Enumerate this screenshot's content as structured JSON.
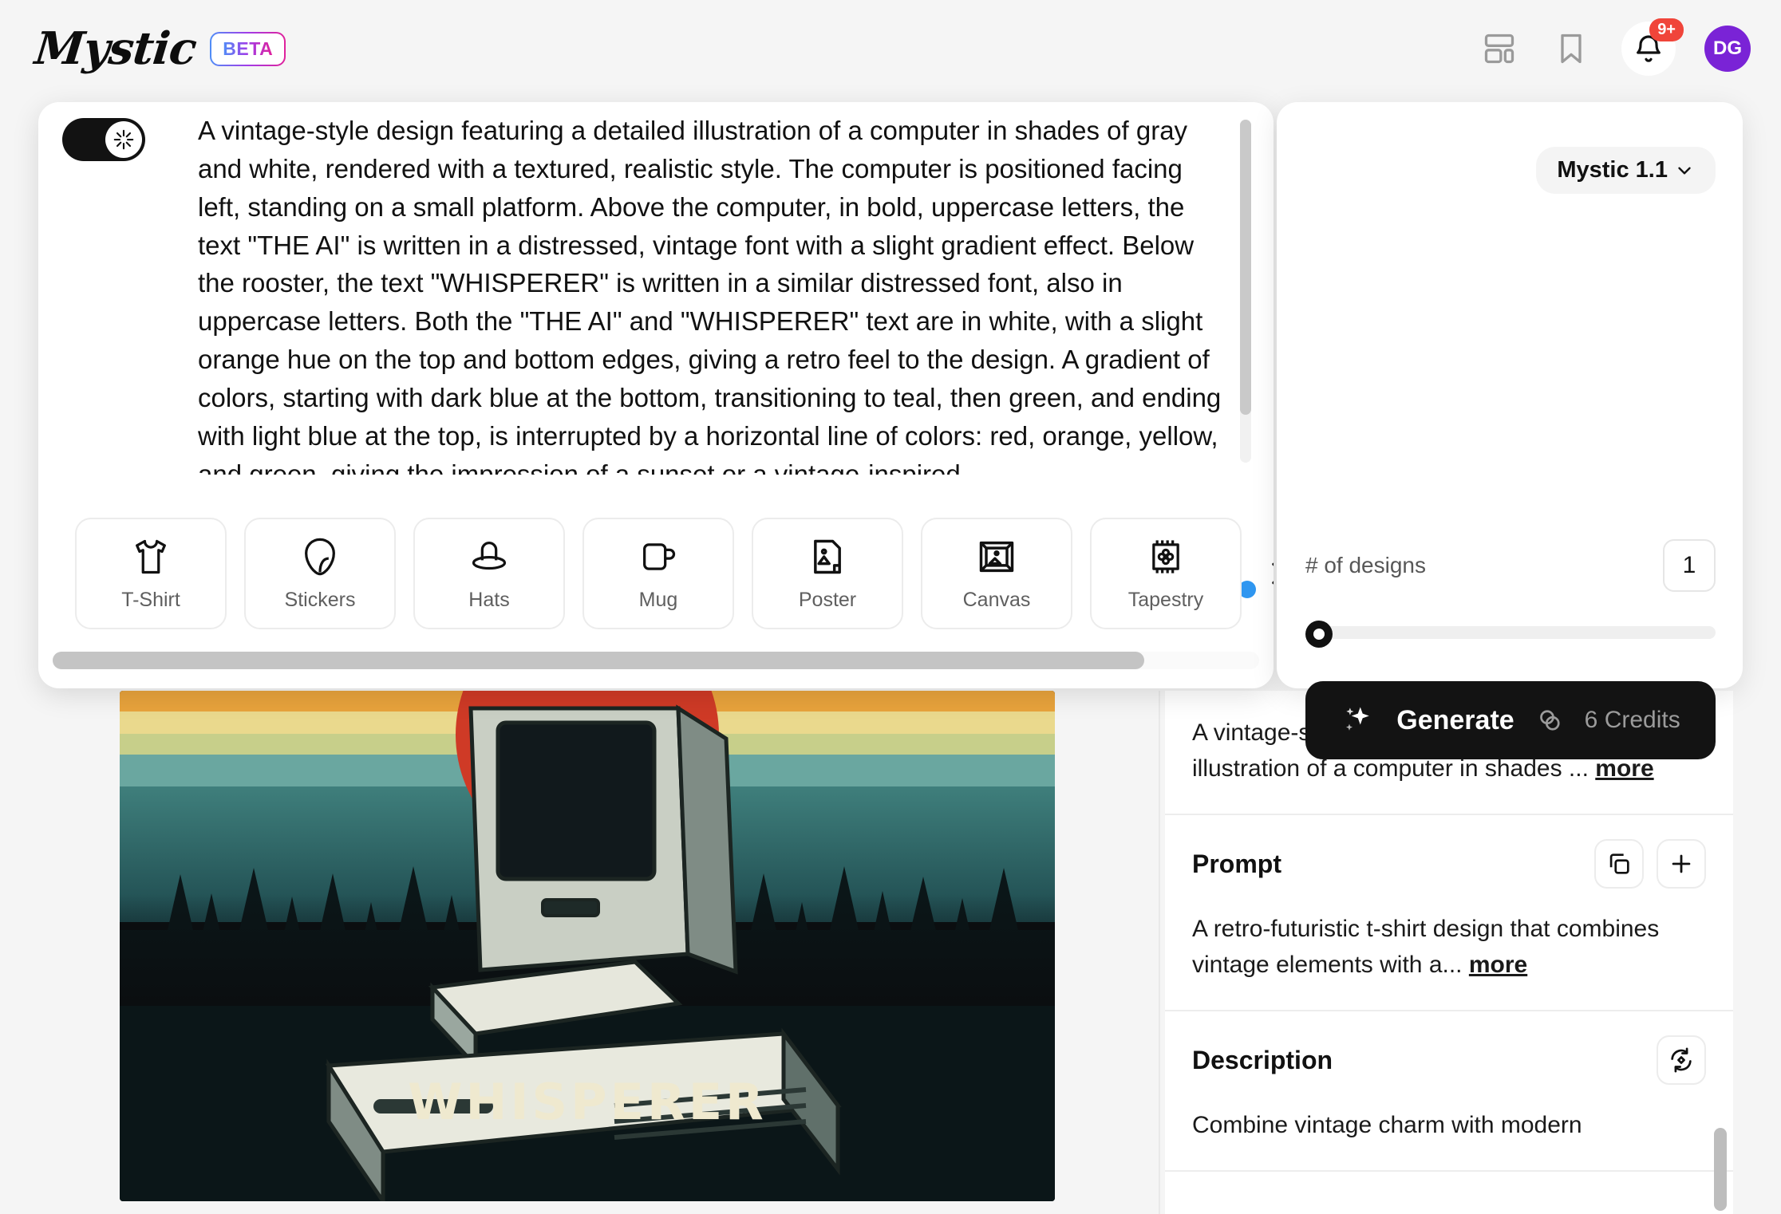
{
  "header": {
    "logo_text": "Mystic",
    "beta_label": "BETA",
    "icons": {
      "dashboard": "dashboard-icon",
      "bookmark": "bookmark-icon",
      "bell": "bell-icon"
    },
    "notification_count": "9+",
    "avatar_initials": "DG"
  },
  "prompt_panel": {
    "enhance_toggle": {
      "state": "on",
      "icon": "sparkle-icon"
    },
    "prompt_text": "A vintage-style design featuring a detailed illustration of a computer in shades of gray and white, rendered with a textured, realistic style. The computer is positioned facing left, standing on a small platform. Above the computer, in bold, uppercase letters, the text \"THE AI\" is written in a distressed, vintage font with a slight gradient effect. Below the rooster, the text \"WHISPERER\" is written in a similar distressed font, also in uppercase letters. Both the \"THE AI\" and \"WHISPERER\" text are in white, with a slight orange hue on the top and bottom edges, giving a retro feel to the design. A gradient of colors, starting with dark blue at the bottom, transitioning to teal, then green, and ending with light blue at the top, is interrupted by a horizontal line of colors: red, orange, yellow, and green, giving the impression of a sunset or a vintage-inspired",
    "categories": [
      {
        "label": "T-Shirt",
        "icon": "tshirt-icon"
      },
      {
        "label": "Stickers",
        "icon": "sticker-icon"
      },
      {
        "label": "Hats",
        "icon": "hat-icon"
      },
      {
        "label": "Mug",
        "icon": "mug-icon"
      },
      {
        "label": "Poster",
        "icon": "poster-icon"
      },
      {
        "label": "Canvas",
        "icon": "canvas-icon"
      },
      {
        "label": "Tapestry",
        "icon": "tapestry-icon"
      }
    ],
    "next_arrow_icon": "chevron-right-icon"
  },
  "controls": {
    "model": "Mystic 1.1",
    "model_chevron_icon": "chevron-down-icon",
    "designs_label": "# of designs",
    "designs_value": "1",
    "generate_label": "Generate",
    "generate_icon": "sparkles-icon",
    "credits_icon": "coins-icon",
    "credits_label": "6 Credits"
  },
  "artwork": {
    "caption": "WHISPERER"
  },
  "sidebar": {
    "summary": {
      "text": "A vintage-style design featuring a detailed illustration of a computer in shades ...",
      "more_label": "more"
    },
    "prompt": {
      "title": "Prompt",
      "copy_icon": "copy-icon",
      "add_icon": "plus-icon",
      "text": "A retro-futuristic t-shirt design that combines vintage elements with a...",
      "more_label": "more"
    },
    "description": {
      "title": "Description",
      "refresh_icon": "refresh-icon",
      "text": "Combine vintage charm with modern"
    }
  },
  "colors": {
    "accent_purple": "#7a23d6",
    "badge_red": "#f0453a",
    "dot_blue": "#2f96f0",
    "button_black": "#131313"
  }
}
